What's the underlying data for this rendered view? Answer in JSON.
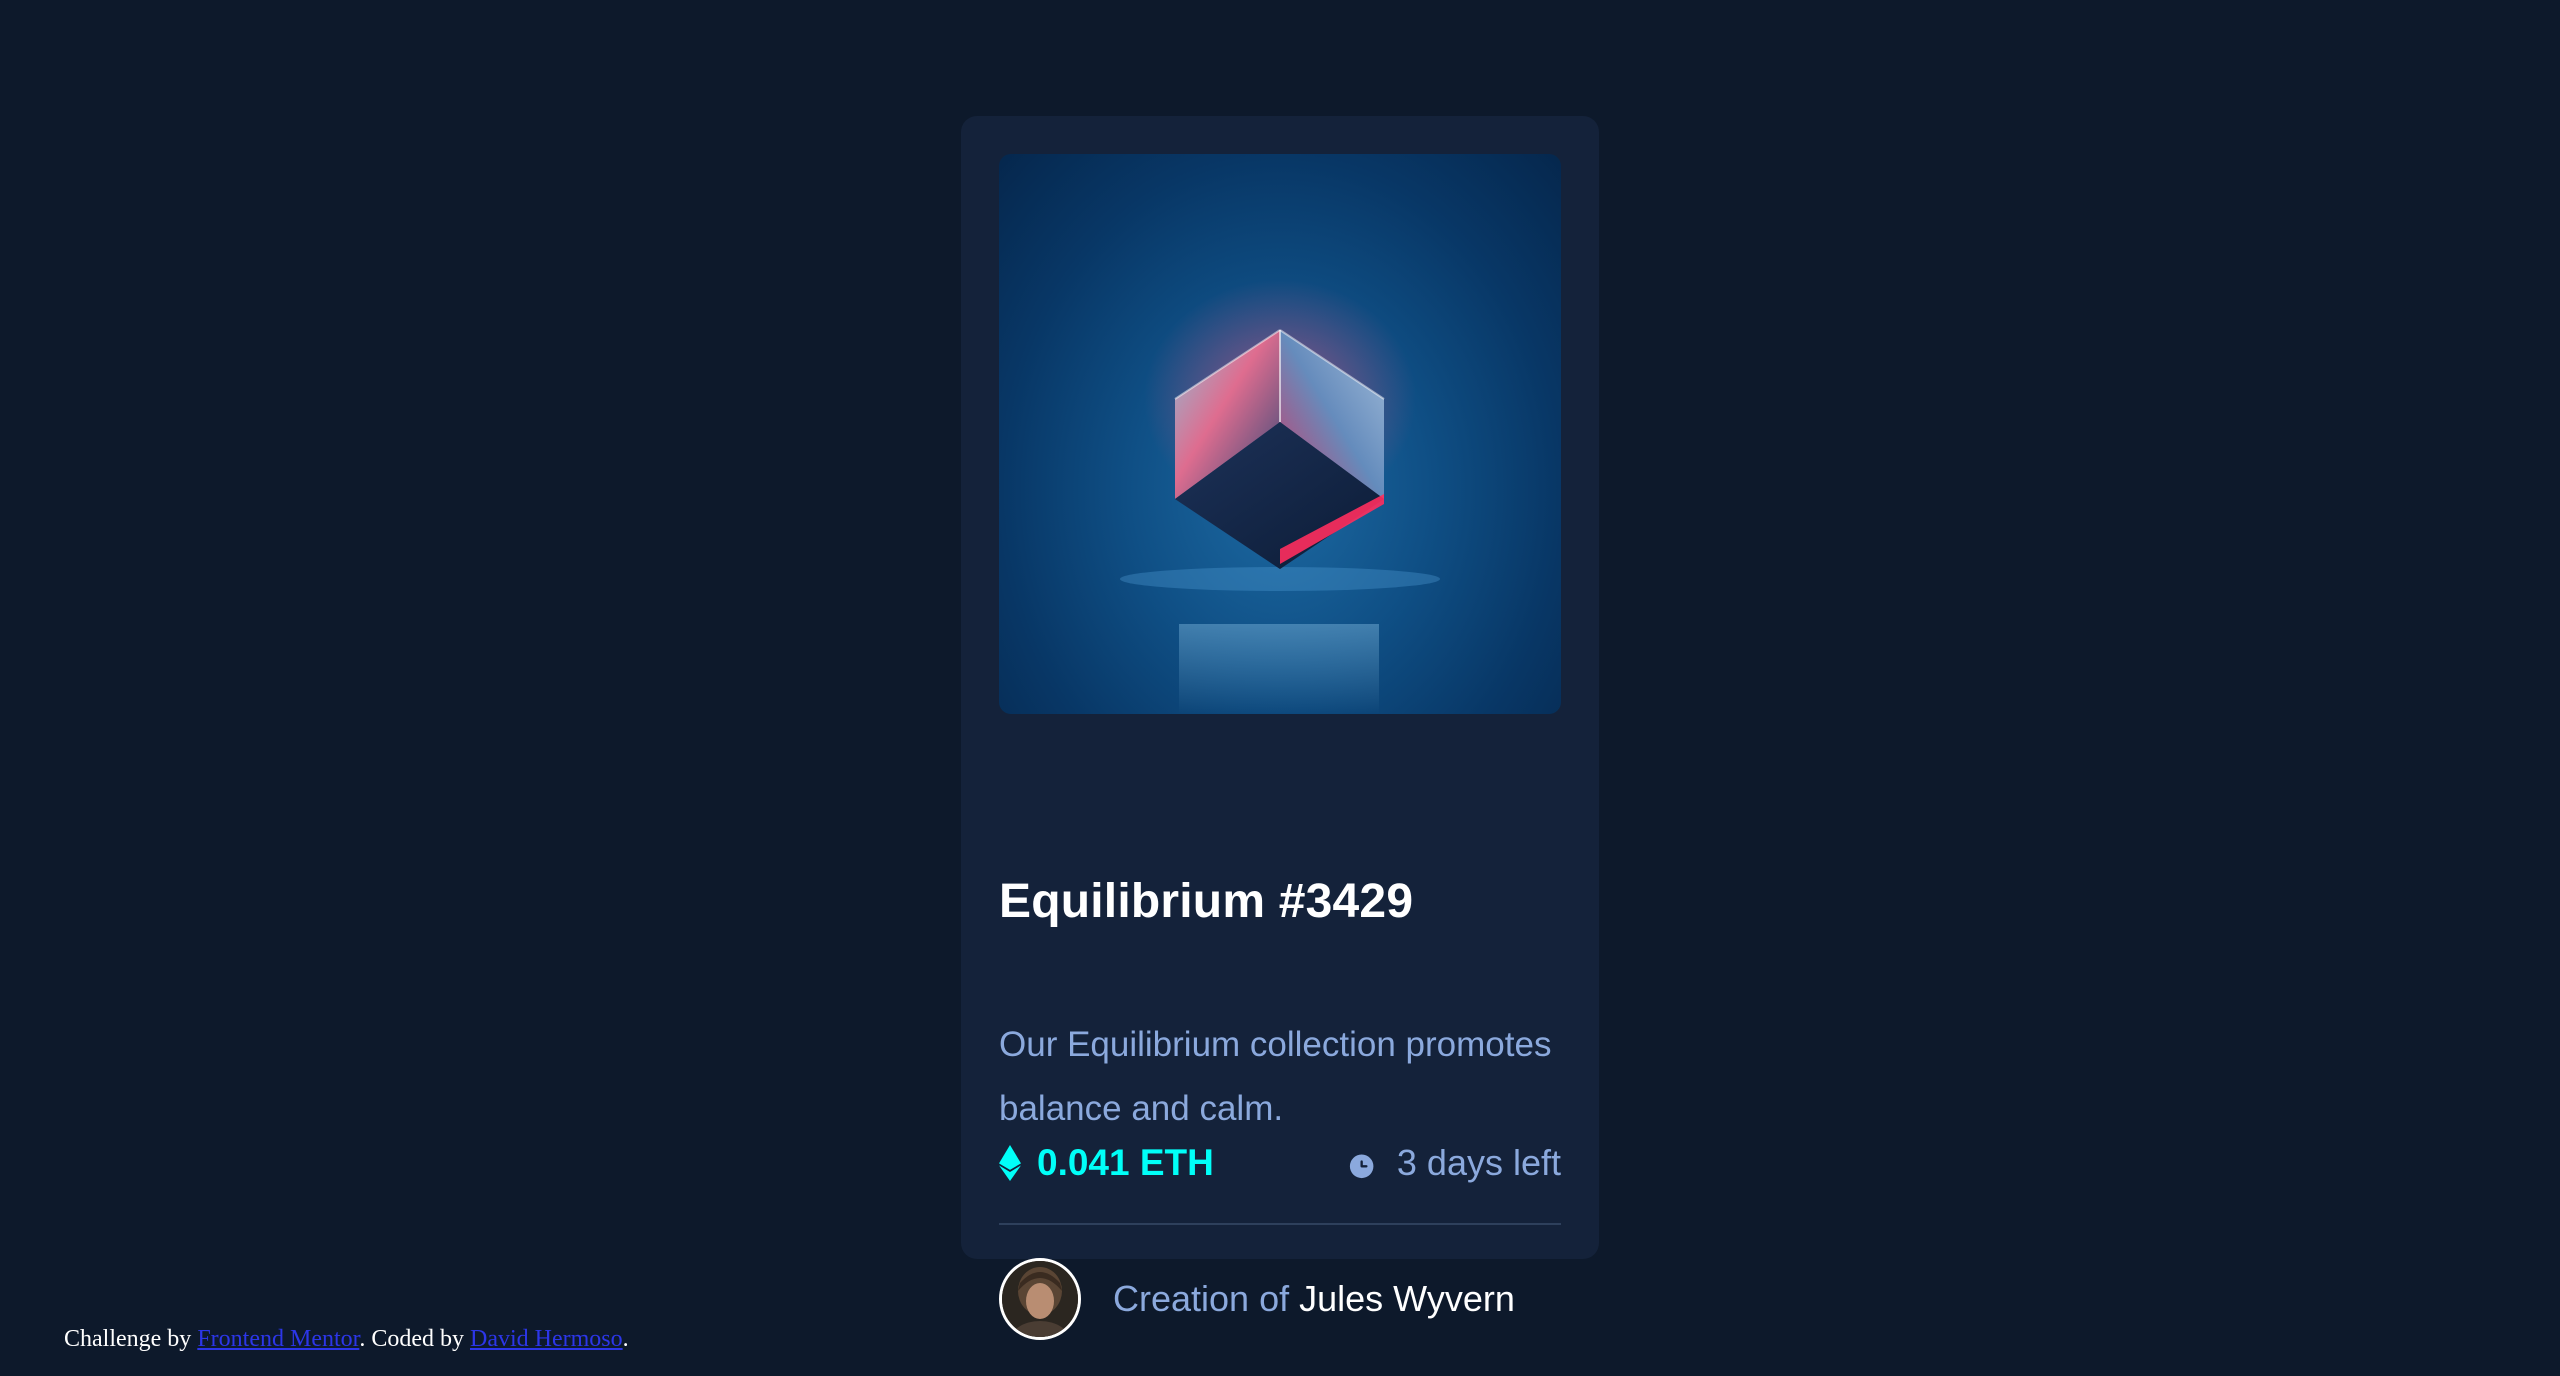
{
  "card": {
    "title": "Equilibrium #3429",
    "description": "Our Equilibrium collection promotes balance and calm.",
    "price": "0.041 ETH",
    "time_left": "3 days left",
    "creator_prefix": "Creation of",
    "creator_name": "Jules Wyvern",
    "hero_alt": "Equilibrium",
    "avatar_alt": "Jules Wyvern"
  },
  "footer": {
    "prefix": "Challenge by",
    "challenge_link": "Frontend Mentor",
    "middle": ". Coded by",
    "author_link": "David Hermoso",
    "suffix": "."
  },
  "icons": {
    "price": "ethereum-icon",
    "time": "clock-icon"
  },
  "colors": {
    "background": "#0d192b",
    "card": "#14223a",
    "accent_cyan": "#00fff8",
    "soft_blue": "#8ba9dd",
    "white": "#ffffff",
    "link": "#2c36e8"
  }
}
